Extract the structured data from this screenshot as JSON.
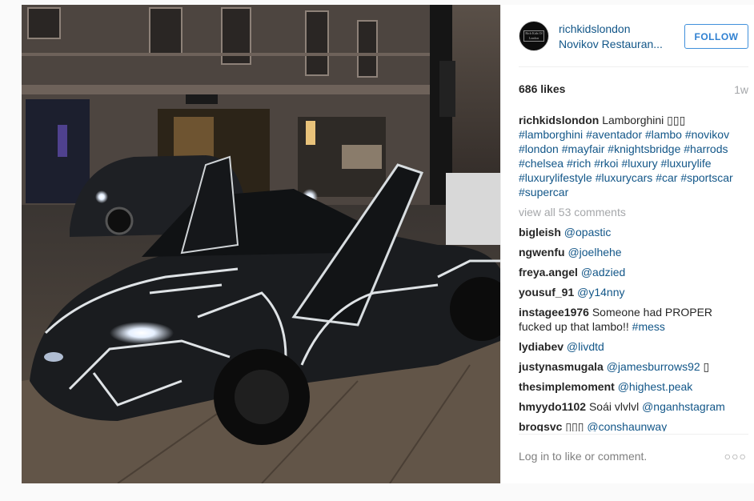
{
  "post": {
    "username": "richkidslondon",
    "location": "Novikov Restauran...",
    "follow_label": "FOLLOW",
    "avatar_text": "Rich Kids Of London",
    "likes": "686 likes",
    "time": "1w",
    "caption": {
      "user": "richkidslondon",
      "text": "Lamborghini ▯▯▯",
      "tags": [
        "#lamborghini",
        "#aventador",
        "#lambo",
        "#novikov",
        "#london",
        "#mayfair",
        "#knightsbridge",
        "#harrods",
        "#chelsea",
        "#rich",
        "#rkoi",
        "#luxury",
        "#luxurylife",
        "#luxurylifestyle",
        "#luxurycars",
        "#car",
        "#sportscar",
        "#supercar"
      ]
    },
    "view_all": "view all 53 comments",
    "comments": [
      {
        "user": "bigleish",
        "mention": "@opastic",
        "text": ""
      },
      {
        "user": "ngwenfu",
        "mention": "@joelhehe",
        "text": ""
      },
      {
        "user": "freya.angel",
        "mention": "@adzied",
        "text": ""
      },
      {
        "user": "yousuf_91",
        "mention": "@y14nny",
        "text": ""
      },
      {
        "user": "instagee1976",
        "mention": "",
        "text": "Someone had PROPER fucked up that lambo!!",
        "tag": "#mess"
      },
      {
        "user": "lydiabev",
        "mention": "@livdtd",
        "text": ""
      },
      {
        "user": "justynasmugala",
        "mention": "@jamesburrows92",
        "text": "",
        "suffix": "▯"
      },
      {
        "user": "thesimplemoment",
        "mention": "@highest.peak",
        "text": ""
      },
      {
        "user": "hmyydo1102",
        "mention": "@nganhstagram",
        "text": "Soái vlvlvl",
        "mention_after": true
      },
      {
        "user": "brogsvc",
        "mention": "@conshaunway",
        "text": "",
        "prefix": "▯▯▯"
      }
    ],
    "login_prompt": "Log in to like or comment.",
    "more_icon": "ellipsis-icon",
    "more_glyph": "○○○"
  },
  "image": {
    "subject": "black Lamborghini Aventador with reflective white outline tape, doors up, on a London street at night"
  }
}
